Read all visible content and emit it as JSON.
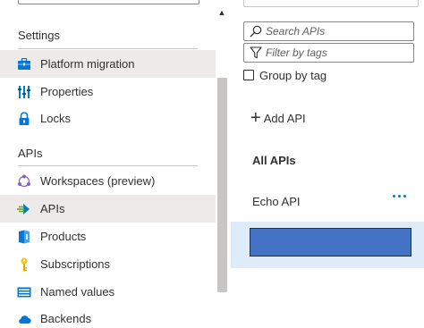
{
  "sidebar": {
    "sections": [
      {
        "title": "Settings"
      },
      {
        "title": "APIs"
      }
    ],
    "items": [
      {
        "label": "Platform migration",
        "icon": "briefcase-icon"
      },
      {
        "label": "Properties",
        "icon": "properties-icon"
      },
      {
        "label": "Locks",
        "icon": "lock-icon"
      },
      {
        "label": "Workspaces (preview)",
        "icon": "workspaces-icon"
      },
      {
        "label": "APIs",
        "icon": "api-arrow-icon"
      },
      {
        "label": "Products",
        "icon": "products-icon"
      },
      {
        "label": "Subscriptions",
        "icon": "key-icon"
      },
      {
        "label": "Named values",
        "icon": "named-values-icon"
      },
      {
        "label": "Backends",
        "icon": "cloud-icon"
      }
    ],
    "scroll_up_glyph": "▲"
  },
  "main": {
    "search": {
      "placeholder": "Search APIs"
    },
    "filter": {
      "placeholder": "Filter by tags"
    },
    "group_by_tag": {
      "label": "Group by tag",
      "checked": false
    },
    "add_api_label": "Add API",
    "list_header": "All APIs",
    "apis": [
      {
        "name": "Echo API"
      }
    ]
  },
  "colors": {
    "selected_nav": "#edebe9",
    "selected_row": "#deecf9",
    "accent": "#0078d4",
    "redaction": "#4472c4"
  }
}
